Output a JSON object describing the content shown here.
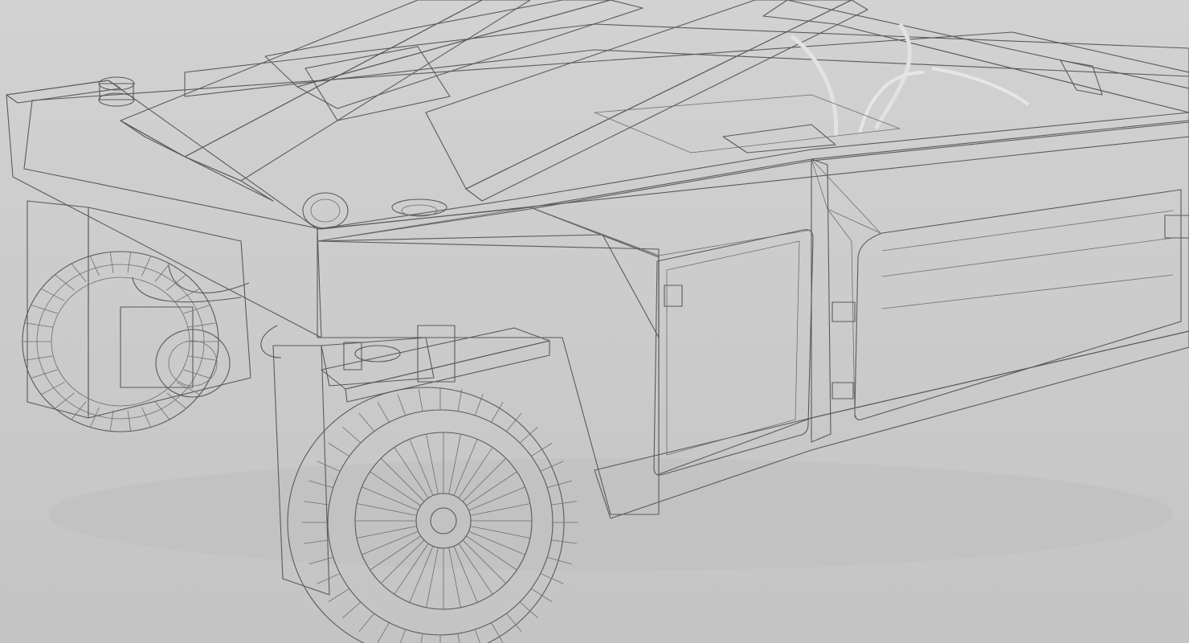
{
  "scene": {
    "subject": "mesh-render",
    "colors": {
      "background": "#c9c9c9",
      "surface_light": "#ededed",
      "surface_mid": "#dcdcdc",
      "surface_shade": "#bdbdbd",
      "surface_dark": "#a6a6a6",
      "wire": "#6e6e6e"
    }
  }
}
